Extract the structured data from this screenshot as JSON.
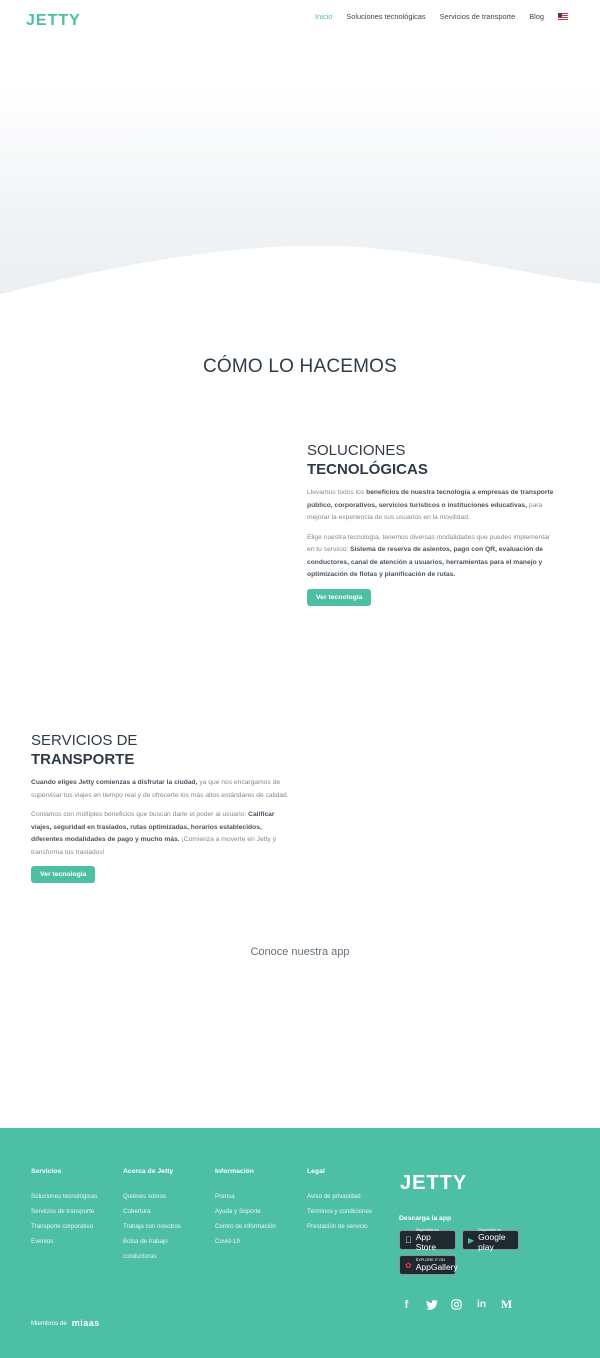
{
  "header": {
    "logo": "JETTY",
    "nav": [
      {
        "label": "Inicio",
        "active": true
      },
      {
        "label": "Soluciones tecnológicas",
        "active": false
      },
      {
        "label": "Servicios de transporte",
        "active": false
      },
      {
        "label": "Blog",
        "active": false
      }
    ],
    "language_flag_icon": "us-flag-icon"
  },
  "main": {
    "section_title": "CÓMO LO HACEMOS",
    "solutions": {
      "title_light": "SOLUCIONES",
      "title_bold": "TECNOLÓGICAS",
      "para1_a": "Llevamos todos los ",
      "para1_b": "beneficios de nuestra tecnología a empresas de transporte público, corporativos, servicios turísticos o instituciones educativas,",
      "para1_c": " para mejorar la experiencia de sus usuarios en la movilidad.",
      "para2_a": "Elige nuestra tecnología, tenemos diversas modalidades que puedes implementar en tu servicio: ",
      "para2_b": "Sistema de reserva de asientos, pago con QR, evaluación de conductores, canal de atención a usuarios, herramientas para el manejo y optimización de flotas y planificación de rutas.",
      "button": "Ver tecnología"
    },
    "transport": {
      "title_light": "SERVICIOS DE",
      "title_bold": "TRANSPORTE",
      "para1_a": "Cuando eliges Jetty comienzas a disfrutar la ciudad,",
      "para1_b": " ya que nos encargamos de supervisar tus viajes en tiempo real y de ofrecerte los más altos estándares de calidad.",
      "para2_a": "Contamos con múltiples beneficios que buscan darle el poder al usuario: ",
      "para2_b": "Calificar viajes, seguridad en traslados, rutas optimizadas, horarios establecidos, diferentes modalidades de pago y mucho más.",
      "para2_c": " ¡Comienza a moverte en Jetty y transforma tus traslados!",
      "button": "Ver tecnología"
    },
    "app_title": "Conoce nuestra app"
  },
  "footer": {
    "columns": [
      {
        "title": "Servicios",
        "items": [
          "Soluciones tecnológicas",
          "Servicios de transporte",
          "Transporte corporativo",
          "Eventos"
        ]
      },
      {
        "title": "Acerca de Jetty",
        "items": [
          "Quiénes somos",
          "Cobertura",
          "Trabaja con nosotros",
          "Bolsa de trabajo",
          "conductoras"
        ]
      },
      {
        "title": "Información",
        "items": [
          "Prensa",
          "Ayuda y Soporte",
          "Centro de información",
          "Covid-19"
        ]
      },
      {
        "title": "Legal",
        "items": [
          "Aviso de privacidad",
          "Términos y condiciones",
          "Prestación de servicio"
        ]
      }
    ],
    "logo": "JETTY",
    "download_label": "Descarga la app",
    "stores": {
      "appstore_small": "Disponible en",
      "appstore_big": "App Store",
      "googleplay_small": "Disponible en",
      "googleplay_big": "Google play",
      "appgallery_small": "EXPLORE IT ON",
      "appgallery_big": "AppGallery"
    },
    "socials": [
      "facebook-icon",
      "twitter-icon",
      "instagram-icon",
      "linkedin-icon",
      "medium-icon"
    ],
    "members_label": "Miembros de",
    "members_logo": "miaas"
  },
  "colors": {
    "accent": "#4dbfa5",
    "text": "#2e3c48",
    "muted": "#7f8a93"
  }
}
